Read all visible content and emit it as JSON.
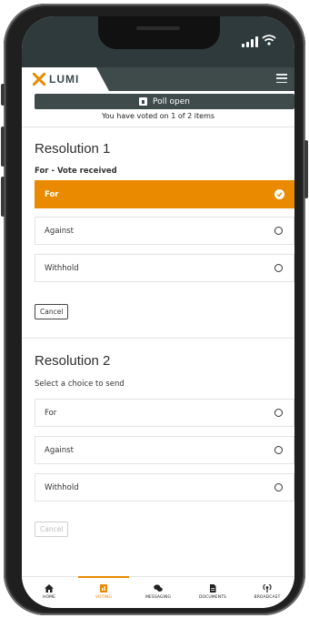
{
  "brand": {
    "name": "LUMI",
    "accent": "#e98a00",
    "header_bg": "#3f4a4b"
  },
  "poll": {
    "status_label": "Poll open",
    "voted_text": "You have voted on 1 of 2 items"
  },
  "resolutions": [
    {
      "title": "Resolution 1",
      "subtitle": "For - Vote received",
      "options": [
        {
          "label": "For",
          "selected": true
        },
        {
          "label": "Against",
          "selected": false
        },
        {
          "label": "Withhold",
          "selected": false
        }
      ],
      "cancel_label": "Cancel",
      "cancel_enabled": true
    },
    {
      "title": "Resolution 2",
      "subtitle": "Select a choice to send",
      "options": [
        {
          "label": "For",
          "selected": false
        },
        {
          "label": "Against",
          "selected": false
        },
        {
          "label": "Withhold",
          "selected": false
        }
      ],
      "cancel_label": "Cancel",
      "cancel_enabled": false
    }
  ],
  "bottom_nav": [
    {
      "label": "HOME",
      "icon": "home-icon",
      "active": false
    },
    {
      "label": "VOTING",
      "icon": "voting-icon",
      "active": true
    },
    {
      "label": "MESSAGING",
      "icon": "messaging-icon",
      "active": false
    },
    {
      "label": "DOCUMENTS",
      "icon": "documents-icon",
      "active": false
    },
    {
      "label": "BROADCAST",
      "icon": "broadcast-icon",
      "active": false
    }
  ]
}
